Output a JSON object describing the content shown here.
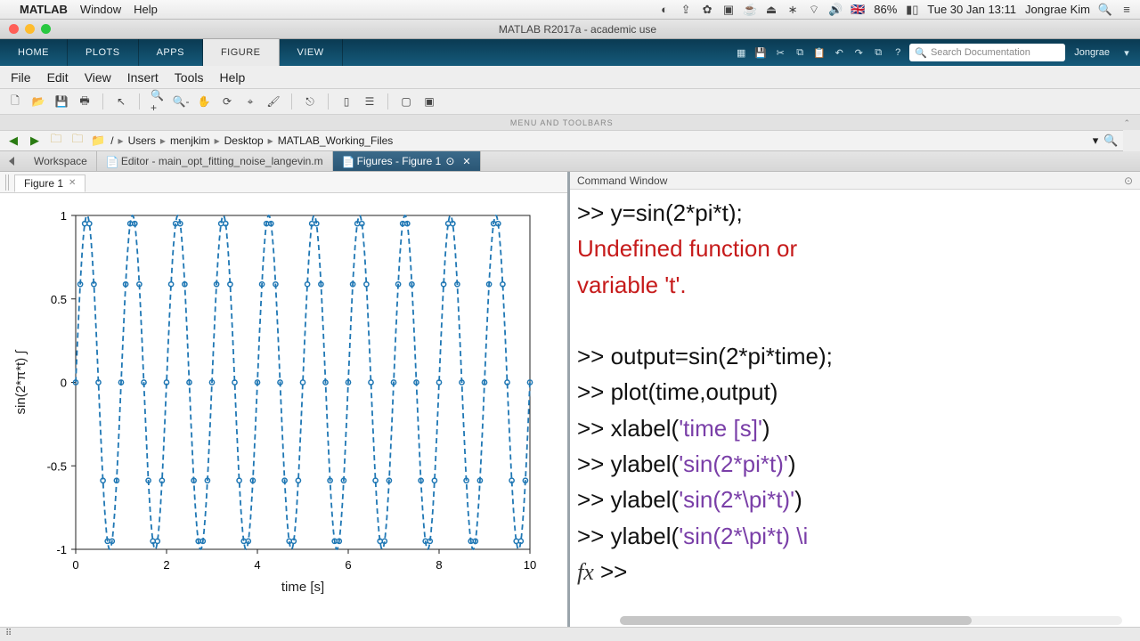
{
  "mac_menu": {
    "app": "MATLAB",
    "items": [
      "Window",
      "Help"
    ],
    "flag": "🇬🇧",
    "battery_pct": "86%",
    "datetime": "Tue 30 Jan  13:11",
    "user": "Jongrae Kim"
  },
  "window": {
    "title": "MATLAB R2017a - academic use"
  },
  "toolstrip": {
    "tabs": [
      "HOME",
      "PLOTS",
      "APPS",
      "FIGURE",
      "VIEW"
    ],
    "active_index": 3,
    "search_placeholder": "Search Documentation",
    "user": "Jongrae"
  },
  "figure_menu": [
    "File",
    "Edit",
    "View",
    "Insert",
    "Tools",
    "Help"
  ],
  "menus_toolbars_label": "MENU AND TOOLBARS",
  "breadcrumb": {
    "segments": [
      "/",
      "Users",
      "menjkim",
      "Desktop",
      "MATLAB_Working_Files"
    ]
  },
  "panel_tabs": [
    {
      "label": "Workspace",
      "active": false
    },
    {
      "label": "Editor - main_opt_fitting_noise_langevin.m",
      "active": false
    },
    {
      "label": "Figures - Figure 1",
      "active": true,
      "closable": true
    }
  ],
  "figure_tab": {
    "label": "Figure 1"
  },
  "command_window": {
    "title": "Command Window",
    "lines": [
      {
        "type": "cmd",
        "prefix": ">> ",
        "code": "y=sin(2*pi*t);"
      },
      {
        "type": "err",
        "text": "Undefined function or"
      },
      {
        "type": "err",
        "text": "variable 't'."
      },
      {
        "type": "blank"
      },
      {
        "type": "cmd",
        "prefix": ">> ",
        "code": "output=sin(2*pi*time);"
      },
      {
        "type": "cmd",
        "prefix": ">> ",
        "code": "plot(time,output)"
      },
      {
        "type": "cmdS",
        "prefix": ">> ",
        "pre": "xlabel(",
        "str": "'time [s]'",
        "post": ")"
      },
      {
        "type": "cmdS",
        "prefix": ">> ",
        "pre": "ylabel(",
        "str": "'sin(2*pi*t)'",
        "post": ")"
      },
      {
        "type": "cmdS",
        "prefix": ">> ",
        "pre": "ylabel(",
        "str": "'sin(2*\\pi*t)'",
        "post": ")"
      },
      {
        "type": "cmdS",
        "prefix": ">> ",
        "pre": "ylabel(",
        "str": "'sin(2*\\pi*t) \\i",
        "post": ""
      },
      {
        "type": "prompt",
        "prefix": ">> "
      }
    ]
  },
  "chart_data": {
    "type": "line",
    "title": "",
    "xlabel": "time [s]",
    "ylabel": "sin(2*π*t) ∫",
    "xlim": [
      0,
      10
    ],
    "ylim": [
      -1,
      1
    ],
    "xticks": [
      0,
      2,
      4,
      6,
      8,
      10
    ],
    "yticks": [
      -1,
      -0.5,
      0,
      0.5,
      1
    ],
    "linestyle": "dashed",
    "marker": "o",
    "color": "#1f77b4",
    "series_description": "y = sin(2*pi*t), t = 0:0.1:10 (101 points), plotted with dashed line and circle markers",
    "x_step": 0.1,
    "n_points": 101,
    "formula": "sin(2*pi*t)"
  }
}
